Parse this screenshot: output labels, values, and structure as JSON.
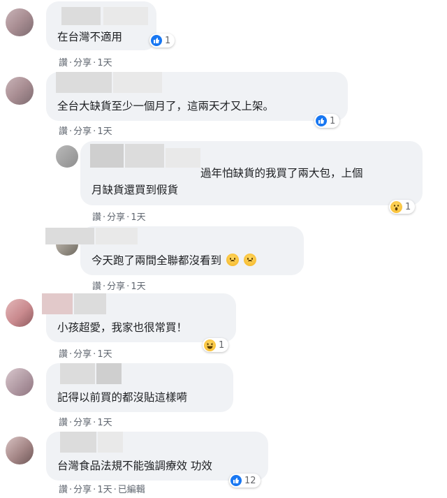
{
  "comments": [
    {
      "text": "在台灣不適用",
      "actions": {
        "read": "讚",
        "share": "分享",
        "time": "1天"
      },
      "reaction": {
        "icon": "like-icon",
        "count": "1"
      }
    },
    {
      "text": "全台大缺貨至少一個月了，這兩天才又上架。",
      "actions": {
        "read": "讚",
        "share": "分享",
        "time": "1天"
      },
      "reaction": {
        "icon": "like-icon",
        "count": "1"
      }
    },
    {
      "text_line1": "過年怕缺貨的我買了兩大包，上個",
      "text_line2": "月缺貨還買到假貨",
      "actions": {
        "read": "讚",
        "share": "分享",
        "time": "1天"
      },
      "reaction": {
        "icon": "wow-icon",
        "count": "1"
      }
    },
    {
      "text": "今天跑了兩間全聯都沒看到",
      "actions": {
        "read": "讚",
        "share": "分享",
        "time": "1天"
      }
    },
    {
      "text": "小孩超愛，我家也很常買！",
      "actions": {
        "read": "讚",
        "share": "分享",
        "time": "1天"
      },
      "reaction": {
        "icon": "haha-icon",
        "count": "1"
      }
    },
    {
      "text": "記得以前買的都沒貼這樣嗬",
      "actions": {
        "read": "讚",
        "share": "分享",
        "time": "1天"
      }
    },
    {
      "text": "台灣食品法規不能強調療效 功效",
      "actions": {
        "read": "讚",
        "share": "分享",
        "time": "1天",
        "edited": "已編輯"
      },
      "reaction": {
        "icon": "like-icon",
        "count": "12"
      }
    }
  ],
  "separator": "·",
  "colors": {
    "bubble": "#f0f2f5",
    "like": "#1877f2",
    "meta": "#606770"
  }
}
